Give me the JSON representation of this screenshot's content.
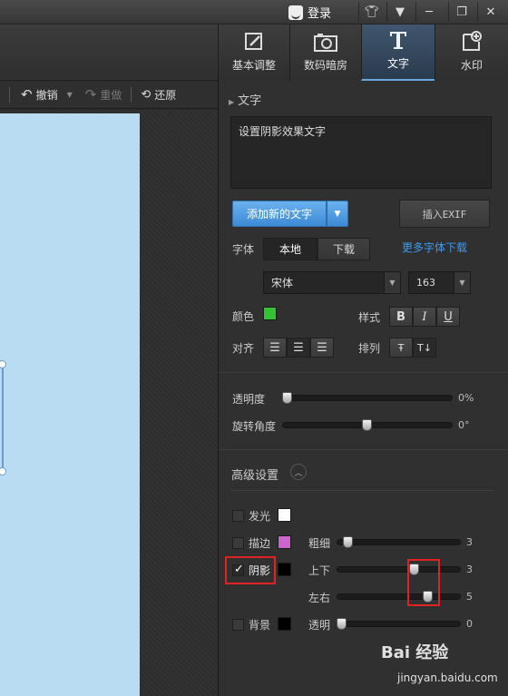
{
  "titlebar": {
    "login_label": "登录"
  },
  "modules": [
    {
      "label": "基本调整",
      "icon": "edit-icon"
    },
    {
      "label": "数码暗房",
      "icon": "camera-icon"
    },
    {
      "label": "文字",
      "icon": "text-icon",
      "active": true
    },
    {
      "label": "水印",
      "icon": "watermark-icon"
    }
  ],
  "edit_toolbar": {
    "undo": "撤销",
    "redo": "重做",
    "restore": "还原"
  },
  "text_panel": {
    "section_title": "文字",
    "text_value": "设置阴影效果文字",
    "add_text": "添加新的文字",
    "insert_exif": "插入EXIF",
    "font_label": "字体",
    "font_tab_local": "本地",
    "font_tab_download": "下载",
    "more_fonts_link": "更多字体下载",
    "font_name": "宋体",
    "font_size": "163",
    "color_label": "颜色",
    "color_value": "#33c233",
    "style_label": "样式",
    "style_bold": "B",
    "style_italic": "I",
    "style_underline": "U",
    "align_label": "对齐",
    "arrange_label": "排列"
  },
  "sliders": {
    "opacity_label": "透明度",
    "opacity_value": "0%",
    "rotate_label": "旋转角度",
    "rotate_value": "0°"
  },
  "advanced": {
    "title": "高级设置",
    "glow_label": "发光",
    "glow_color": "#ffffff",
    "stroke_label": "描边",
    "stroke_color": "#cc66cc",
    "stroke_thickness_label": "粗细",
    "stroke_thickness_value": "3",
    "shadow_label": "阴影",
    "shadow_checked": true,
    "shadow_color": "#000000",
    "shadow_vertical_label": "上下",
    "shadow_vertical_value": "3",
    "shadow_horizontal_label": "左右",
    "shadow_horizontal_value": "5",
    "background_label": "背景",
    "background_color": "#000000",
    "background_opacity_label": "透明",
    "background_opacity_value": "0"
  },
  "watermark": {
    "brand": "Bai 经验",
    "url": "jingyan.baidu.com"
  }
}
